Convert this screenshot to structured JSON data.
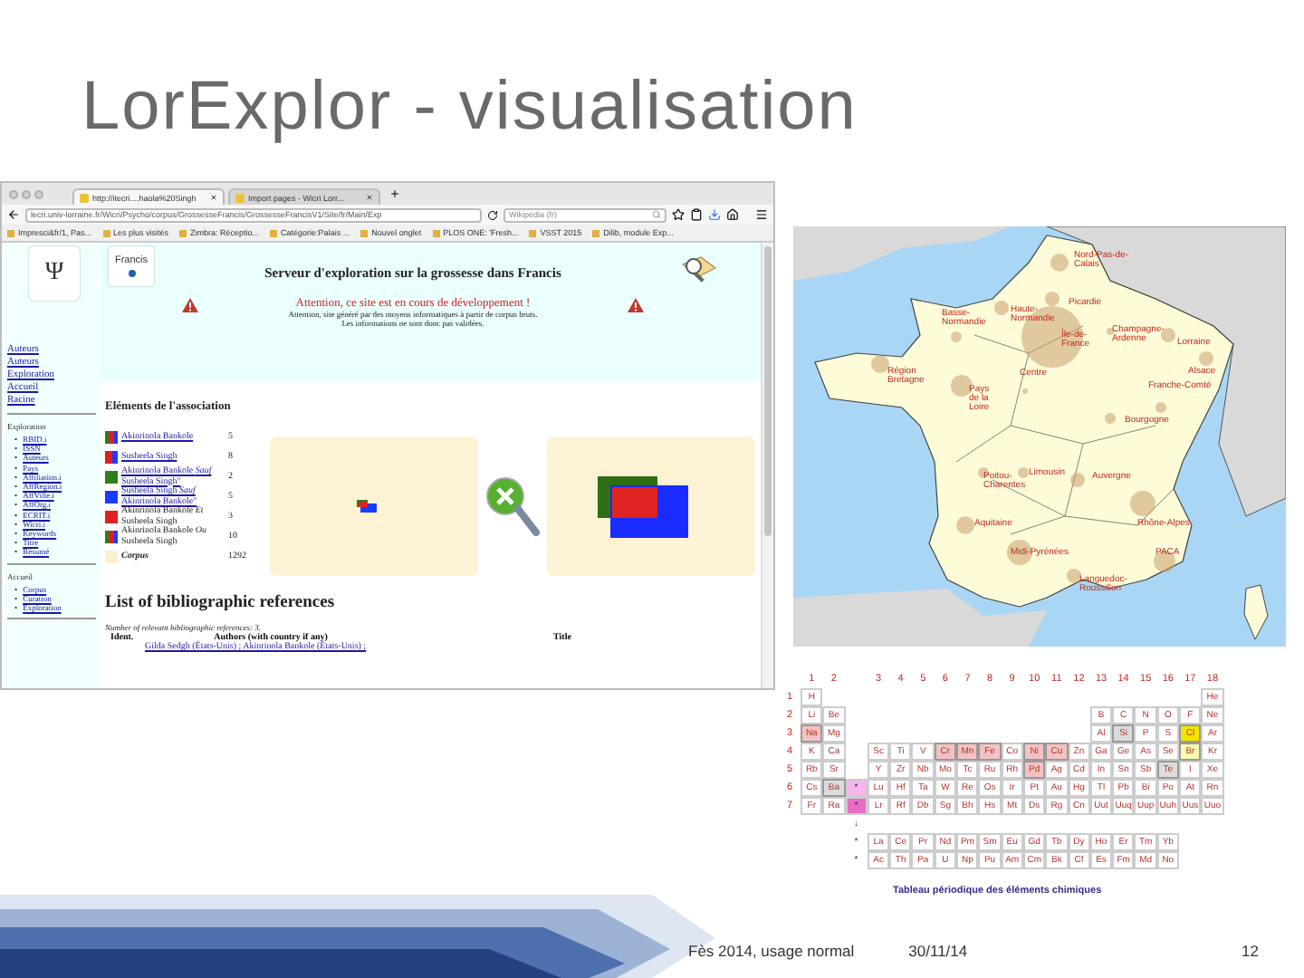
{
  "slide": {
    "title": "LorExplor - visualisation"
  },
  "browser": {
    "tabs": [
      {
        "label": "http://itecri....haola%20Singh",
        "selected": true
      },
      {
        "label": "Import pages - Wicri Lorr...",
        "selected": false
      }
    ],
    "address": "lecri.univ-lorraine.fr/Wicri/Psycho/corpus/GrossesseFrancis/GrossesseFrancisV1/Site/fr/Main/Exp",
    "search_placeholder": "Wikipédia (fr)",
    "bookmarks": [
      "Impresci&fr/1, Pas...",
      "Les plus visités",
      "Zimbra: Réceptio...",
      "Catégorie:Palais ...",
      "Nouvel onglet",
      "PLOS ONE: 'Fresh...",
      "VSST 2015",
      "Dilib, module Exp..."
    ]
  },
  "page": {
    "psi_logo": "Ψ",
    "francis_logo": "Francis",
    "title": "Serveur d'exploration sur la grossesse dans Francis",
    "warning": "Attention, ce site est en cours de développement !",
    "notice": [
      "Attention, site généré par des moyens informatiques à partir de corpus bruts.",
      "Les informations ne sont donc pas validées."
    ],
    "sidebar": {
      "links": [
        "Auteurs",
        "Auteurs",
        "Exploration",
        "Accueil",
        "Racine"
      ],
      "sections": [
        {
          "heading": "Exploration",
          "bullet": "•",
          "items": [
            "RBID.i",
            "ISSN",
            "Auteurs",
            "Pays",
            "Affiliation.i",
            "AffRegion.i",
            "AffVille.i",
            "AffOrg.i",
            "ECRIT.i",
            "Wicri.i",
            "Keywords",
            "Titre",
            "Résumé"
          ]
        },
        {
          "heading": "Accueil",
          "bullet": "•",
          "items": [
            "Corpus",
            "Curation",
            "Exploration"
          ]
        }
      ]
    },
    "association": {
      "heading": "Eléments de l'association",
      "rows": [
        {
          "label": "Akinrinola Bankole",
          "count": "5",
          "swatch": [
            {
              "color": "#2e7d1e"
            },
            {
              "color": "#e02020"
            },
            {
              "color": "#1a3cff"
            }
          ],
          "linked": true
        },
        {
          "label": "Susheela Singh",
          "count": "8",
          "swatch": [
            {
              "color": "#e02020"
            },
            {
              "color": "#1a3cff"
            }
          ],
          "linked": true
        },
        {
          "label": "Akinrinola Bankole *Sauf* Susheela Singh\"",
          "count": "2",
          "swatch": [
            {
              "color": "#2e7d1e"
            }
          ],
          "linked": true
        },
        {
          "label": "Susheela Singh *Sauf* Akinrinola Bankole\"",
          "count": "5",
          "swatch": [
            {
              "color": "#1a3cff"
            }
          ],
          "linked": true
        },
        {
          "label": "Akinrinola Bankole *Et* Susheela Singh",
          "count": "3",
          "swatch": [
            {
              "color": "#e02020"
            }
          ],
          "linked": false
        },
        {
          "label": "Akinrinola Bankole *Ou* Susheela Singh",
          "count": "10",
          "swatch": [
            {
              "color": "#2e7d1e"
            },
            {
              "color": "#e02020"
            },
            {
              "color": "#1a3cff"
            }
          ],
          "linked": false
        },
        {
          "label": "Corpus",
          "count": "1292",
          "swatch": [
            {
              "color": "#fcefd0"
            }
          ],
          "linked": false
        }
      ]
    },
    "references": {
      "heading": "List of bibliographic references",
      "count_note": "Number of relevant bibliographic references: 3.",
      "columns": [
        "Ident.",
        "Authors (with country if any)",
        "Title"
      ],
      "first_row": "Gilda Sedgh (États-Unis) ; Akinrinola Bankole (États-Unis) ;"
    }
  },
  "map": {
    "regions": [
      "Nord-Pas-de-Calais",
      "Picardie",
      "Basse-Normandie",
      "Haute-Normandie",
      "Île-de-France",
      "Champagne-Ardenne",
      "Lorraine",
      "Région Bretagne",
      "Centre",
      "Alsace",
      "Pays de la Loire",
      "Franche-Comté",
      "Bourgogne",
      "Poitou-Charentes",
      "Limousin",
      "Auvergne",
      "Aquitaine",
      "Rhône-Alpes",
      "Midi-Pyrénées",
      "PACA",
      "Languedoc-Roussillon"
    ]
  },
  "periodic_table": {
    "groups": [
      "1",
      "2",
      "3",
      "4",
      "5",
      "6",
      "7",
      "8",
      "9",
      "10",
      "11",
      "12",
      "13",
      "14",
      "15",
      "16",
      "17",
      "18"
    ],
    "periods": [
      {
        "label": "1",
        "cells": [
          {
            "symbol": "H"
          },
          {
            "symbol": "He"
          }
        ]
      },
      {
        "label": "2",
        "cells": [
          {
            "symbol": "Li"
          },
          {
            "symbol": "Be"
          },
          {
            "symbol": "B"
          },
          {
            "symbol": "C"
          },
          {
            "symbol": "N"
          },
          {
            "symbol": "O"
          },
          {
            "symbol": "F"
          },
          {
            "symbol": "Ne"
          }
        ]
      },
      {
        "label": "3",
        "cells": [
          {
            "symbol": "Na",
            "color": "#f4c2c2"
          },
          {
            "symbol": "Mg"
          },
          {
            "symbol": "Al"
          },
          {
            "symbol": "Si",
            "color": "#dcdcdc"
          },
          {
            "symbol": "P"
          },
          {
            "symbol": "S"
          },
          {
            "symbol": "Cl",
            "color": "#f2e600"
          },
          {
            "symbol": "Ar"
          }
        ]
      },
      {
        "label": "4",
        "cells": [
          {
            "symbol": "K"
          },
          {
            "symbol": "Ca"
          },
          {
            "symbol": "Sc"
          },
          {
            "symbol": "Ti"
          },
          {
            "symbol": "V"
          },
          {
            "symbol": "Cr",
            "color": "#f4c2c2"
          },
          {
            "symbol": "Mn",
            "color": "#f4c2c2"
          },
          {
            "symbol": "Fe",
            "color": "#f4c2c2"
          },
          {
            "symbol": "Co"
          },
          {
            "symbol": "Ni",
            "color": "#f4c2c2"
          },
          {
            "symbol": "Cu",
            "color": "#f4c2c2"
          },
          {
            "symbol": "Zn"
          },
          {
            "symbol": "Ga"
          },
          {
            "symbol": "Ge"
          },
          {
            "symbol": "As"
          },
          {
            "symbol": "Se"
          },
          {
            "symbol": "Br",
            "color": "#fafab0"
          },
          {
            "symbol": "Kr"
          }
        ]
      },
      {
        "label": "5",
        "cells": [
          {
            "symbol": "Rb"
          },
          {
            "symbol": "Sr"
          },
          {
            "symbol": "Y"
          },
          {
            "symbol": "Zr"
          },
          {
            "symbol": "Nb"
          },
          {
            "symbol": "Mo"
          },
          {
            "symbol": "Tc"
          },
          {
            "symbol": "Ru"
          },
          {
            "symbol": "Rh"
          },
          {
            "symbol": "Pd",
            "color": "#f4c2c2"
          },
          {
            "symbol": "Ag"
          },
          {
            "symbol": "Cd"
          },
          {
            "symbol": "In"
          },
          {
            "symbol": "Sn"
          },
          {
            "symbol": "Sb"
          },
          {
            "symbol": "Te",
            "color": "#dcdcdc"
          },
          {
            "symbol": "I"
          },
          {
            "symbol": "Xe"
          }
        ]
      },
      {
        "label": "6",
        "marker": {
          "text": "*",
          "color": "#f7b5ee"
        },
        "cells": [
          {
            "symbol": "Cs"
          },
          {
            "symbol": "Ba",
            "color": "#dcdcdc"
          },
          {
            "symbol": "Lu"
          },
          {
            "symbol": "Hf"
          },
          {
            "symbol": "Ta"
          },
          {
            "symbol": "W"
          },
          {
            "symbol": "Re"
          },
          {
            "symbol": "Os"
          },
          {
            "symbol": "Ir"
          },
          {
            "symbol": "Pt"
          },
          {
            "symbol": "Au"
          },
          {
            "symbol": "Hg"
          },
          {
            "symbol": "Tl"
          },
          {
            "symbol": "Pb"
          },
          {
            "symbol": "Bi"
          },
          {
            "symbol": "Po"
          },
          {
            "symbol": "At"
          },
          {
            "symbol": "Rn"
          }
        ]
      },
      {
        "label": "7",
        "marker": {
          "text": "*",
          "color": "#e86cc4"
        },
        "cells": [
          {
            "symbol": "Fr"
          },
          {
            "symbol": "Ra"
          },
          {
            "symbol": "Lr"
          },
          {
            "symbol": "Rf"
          },
          {
            "symbol": "Db"
          },
          {
            "symbol": "Sg"
          },
          {
            "symbol": "Bh"
          },
          {
            "symbol": "Hs"
          },
          {
            "symbol": "Mt"
          },
          {
            "symbol": "Ds"
          },
          {
            "symbol": "Rg"
          },
          {
            "symbol": "Cn"
          },
          {
            "symbol": "Uut"
          },
          {
            "symbol": "Uuq"
          },
          {
            "symbol": "Uup"
          },
          {
            "symbol": "Uuh"
          },
          {
            "symbol": "Uus"
          },
          {
            "symbol": "Uuo"
          }
        ]
      }
    ],
    "arrow": "↓",
    "series": [
      {
        "marker": "*",
        "cells": [
          "La",
          "Ce",
          "Pr",
          "Nd",
          "Pm",
          "Sm",
          "Eu",
          "Gd",
          "Tb",
          "Dy",
          "Ho",
          "Er",
          "Tm",
          "Yb"
        ]
      },
      {
        "marker": "*",
        "cells": [
          "Ac",
          "Th",
          "Pa",
          "U",
          "Np",
          "Pu",
          "Am",
          "Cm",
          "Bk",
          "Cf",
          "Es",
          "Fm",
          "Md",
          "No"
        ]
      }
    ],
    "caption": "Tableau périodique des éléments chimiques"
  },
  "footer": {
    "event": "Fès 2014, usage normal",
    "date": "30/11/14",
    "page": "12"
  }
}
